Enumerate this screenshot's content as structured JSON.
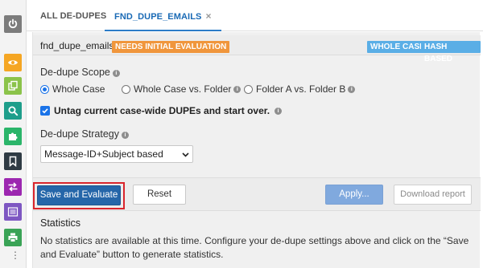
{
  "sidebar": {
    "items": [
      {
        "name": "power-icon",
        "color": "#7c7c7c"
      },
      {
        "name": "eye-icon",
        "color": "#f5a623"
      },
      {
        "name": "copy-icon",
        "color": "#8bc34a"
      },
      {
        "name": "search-icon",
        "color": "#1e9e8b"
      },
      {
        "name": "puzzle-icon",
        "color": "#2bb56a"
      },
      {
        "name": "bookmark-icon",
        "color": "#2f3b44"
      },
      {
        "name": "swap-arrows-icon",
        "color": "#9c27b0"
      },
      {
        "name": "list-icon",
        "color": "#7e57c2"
      },
      {
        "name": "print-icon",
        "color": "#3aa356"
      }
    ],
    "more": "⋮"
  },
  "tabs": {
    "all_label": "ALL DE-DUPES",
    "active_label": "FND_DUPE_EMAILS",
    "close_glyph": "×"
  },
  "header": {
    "case_name": "fnd_dupe_emails",
    "status_badge": "NEEDS INITIAL EVALUATION",
    "badge_scope": "WHOLE CASE",
    "badge_method": "HASH BASED",
    "status_color": "#f0963c",
    "badge_color": "#5aaee6"
  },
  "scope": {
    "label": "De-dupe Scope",
    "options": [
      {
        "label": "Whole Case",
        "checked": true
      },
      {
        "label": "Whole Case vs. Folder",
        "checked": false
      },
      {
        "label": "Folder A vs. Folder B",
        "checked": false
      }
    ],
    "untag_label": "Untag current case-wide DUPEs and start over.",
    "untag_checked": true
  },
  "strategy": {
    "label": "De-dupe Strategy",
    "selected": "Message-ID+Subject based"
  },
  "buttons": {
    "save_evaluate": "Save and Evaluate",
    "reset": "Reset",
    "apply": "Apply...",
    "download": "Download report",
    "primary_color": "#2566a9",
    "highlight_color": "#d9252c"
  },
  "statistics": {
    "title": "Statistics",
    "text": "No statistics are available at this time. Configure your de-dupe settings above and click on the “Save and Evaluate” button to generate statistics."
  }
}
